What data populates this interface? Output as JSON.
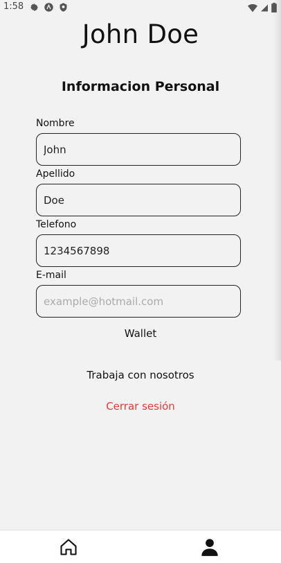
{
  "status_bar": {
    "time": "1:58",
    "left_icons": [
      "settings-icon",
      "app-a-icon",
      "shield-icon"
    ],
    "right_icons": [
      "wifi-icon",
      "signal-icon",
      "battery-icon"
    ]
  },
  "profile": {
    "name": "John Doe",
    "section_title": "Informacion Personal"
  },
  "form": {
    "nombre": {
      "label": "Nombre",
      "value": "John"
    },
    "apellido": {
      "label": "Apellido",
      "value": "Doe"
    },
    "telefono": {
      "label": "Telefono",
      "value": "1234567898"
    },
    "email": {
      "label": "E-mail",
      "value": "",
      "placeholder": "example@hotmail.com"
    }
  },
  "links": {
    "wallet": "Wallet",
    "trabaja": "Trabaja con nosotros",
    "logout": "Cerrar sesión"
  },
  "colors": {
    "background": "#f2f2f2",
    "logout": "#e53935"
  },
  "bottom_nav": {
    "items": [
      {
        "icon": "home-icon",
        "active": false
      },
      {
        "icon": "person-icon",
        "active": true
      }
    ]
  }
}
